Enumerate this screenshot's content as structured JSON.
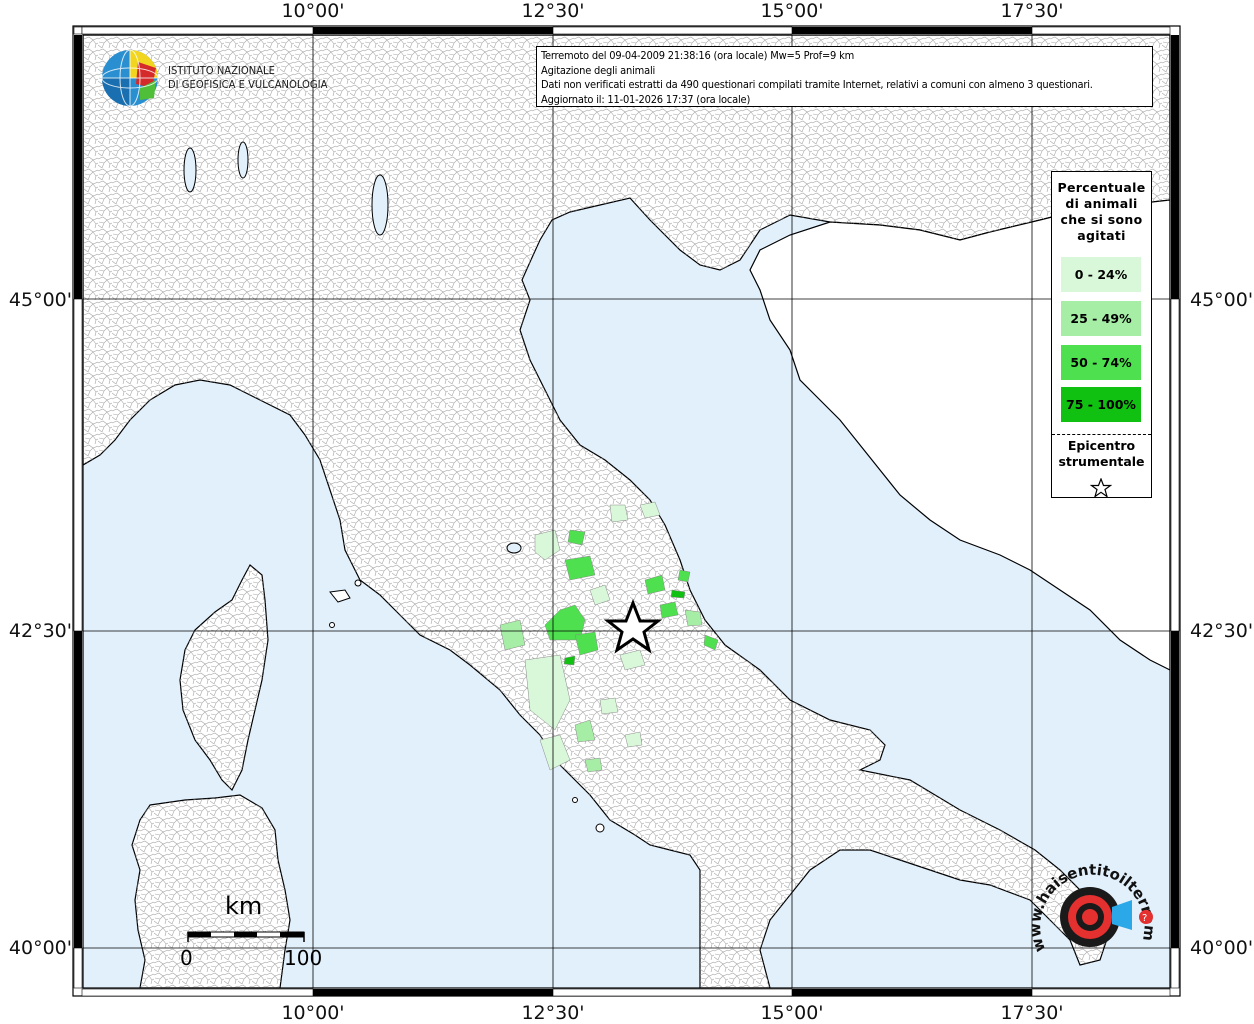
{
  "grid": {
    "lon_labels": [
      "10°00'",
      "12°30'",
      "15°00'",
      "17°30'"
    ],
    "lat_labels": [
      "45°00'",
      "42°30'",
      "40°00'"
    ]
  },
  "info": {
    "line1": "Terremoto del 09-04-2009 21:38:16 (ora locale) Mw=5 Prof=9 km",
    "line2": "Agitazione degli animali",
    "line3": "Dati non verificati estratti da 490 questionari compilati tramite Internet, relativi a comuni con almeno 3 questionari.",
    "line4": "Aggiornato il: 11-01-2026 17:37 (ora locale)"
  },
  "legend": {
    "title_lines": [
      "Percentuale",
      "di animali",
      "che si sono",
      "agitati"
    ],
    "classes": [
      {
        "label": "0 - 24%",
        "color": "#d9f7d9"
      },
      {
        "label": "25 - 49%",
        "color": "#a6eea6"
      },
      {
        "label": "50 - 74%",
        "color": "#4fe04f"
      },
      {
        "label": "75 - 100%",
        "color": "#11c111"
      }
    ],
    "epicenter_lines": [
      "Epicentro",
      "strumentale"
    ]
  },
  "institute": {
    "line1": "ISTITUTO NAZIONALE",
    "line2": "DI GEOFISICA E VULCANOLOGIA"
  },
  "scale": {
    "unit": "km",
    "min": "0",
    "max": "100"
  },
  "badge": {
    "text": "www.haisentitoilterremoto.it"
  },
  "colors": {
    "sea": "#e2f0fc",
    "land": "#ffffff",
    "border": "#9a9a9a",
    "coast": "#000000"
  },
  "icons": {
    "epicenter": "star-icon",
    "institute_logo": "ingv-globe-icon",
    "badge_logo": "haisentito-target-icon"
  }
}
